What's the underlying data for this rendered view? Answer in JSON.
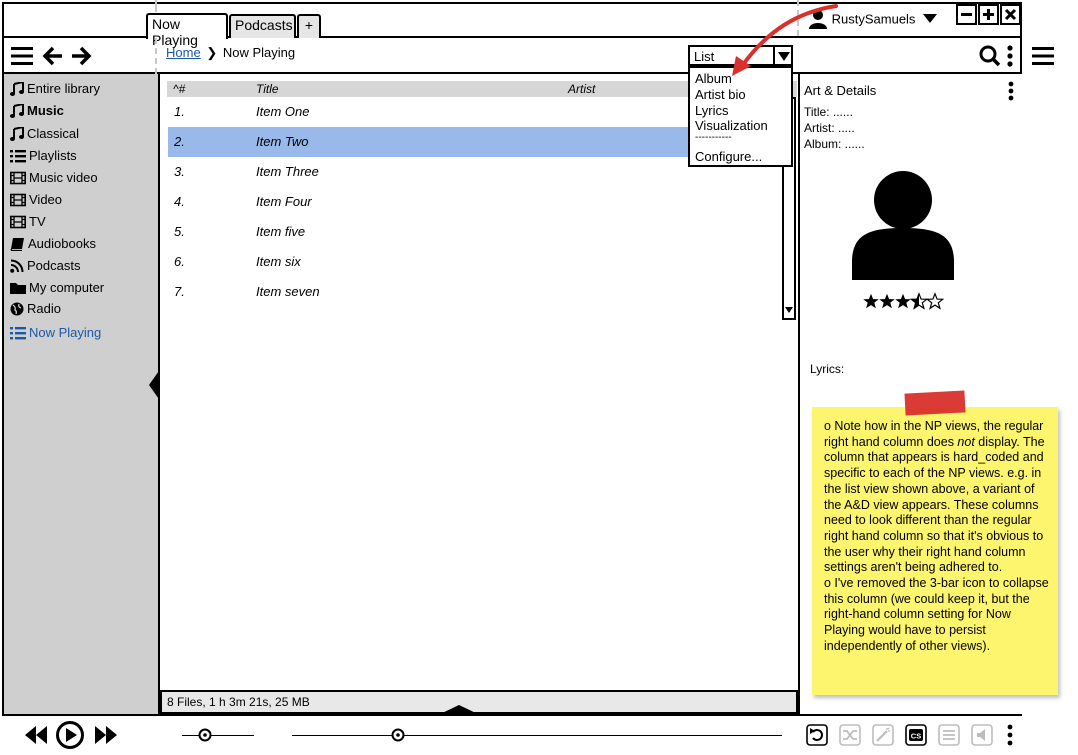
{
  "tabs": [
    {
      "label": "Now Playing",
      "active": true
    },
    {
      "label": "Podcasts",
      "active": false
    },
    {
      "label": "+",
      "active": false
    }
  ],
  "user": {
    "name": "RustySamuels"
  },
  "window_controls": {
    "minimize": "−",
    "maximize": "+",
    "close": "×"
  },
  "breadcrumb": {
    "home": "Home",
    "separator": "❯",
    "current": "Now Playing"
  },
  "view_select": {
    "value": "List",
    "options": [
      "Album",
      "Artist bio",
      "Lyrics",
      "Visualization",
      "-----------",
      "Configure..."
    ]
  },
  "sidebar": {
    "items": [
      {
        "label": "Entire library",
        "icon": "music-note-icon"
      },
      {
        "label": "Music",
        "icon": "music-note-icon",
        "bold": true
      },
      {
        "label": "Classical",
        "icon": "music-note-icon"
      },
      {
        "label": "Playlists",
        "icon": "list-icon"
      },
      {
        "label": "Music video",
        "icon": "film-icon"
      },
      {
        "label": "Video",
        "icon": "film-icon"
      },
      {
        "label": "TV",
        "icon": "film-icon"
      },
      {
        "label": "Audiobooks",
        "icon": "book-icon"
      },
      {
        "label": "Podcasts",
        "icon": "rss-icon"
      },
      {
        "label": "My computer",
        "icon": "folder-icon"
      },
      {
        "label": "Radio",
        "icon": "globe-icon"
      },
      {
        "label": "Now Playing",
        "icon": "list-icon",
        "active": true
      }
    ]
  },
  "list": {
    "columns": {
      "number": "^#",
      "title": "Title",
      "artist": "Artist"
    },
    "rows": [
      {
        "num": "1.",
        "title": "Item One"
      },
      {
        "num": "2.",
        "title": "Item Two",
        "selected": true
      },
      {
        "num": "3.",
        "title": "Item Three"
      },
      {
        "num": "4.",
        "title": "Item Four"
      },
      {
        "num": "5.",
        "title": "Item five"
      },
      {
        "num": "6.",
        "title": "Item six"
      },
      {
        "num": "7.",
        "title": "Item seven"
      }
    ]
  },
  "details": {
    "heading": "Art & Details",
    "title_label": "Title: ......",
    "artist_label": "Artist: .....",
    "album_label": "Album: ......",
    "rating": 3.5,
    "rating_max": 5,
    "lyrics_label": "Lyrics:"
  },
  "status": {
    "text": "8 Files, 1 h 3m 21s, 25 MB"
  },
  "note": {
    "line1_a": "o Note how in the NP views, the regular right hand column does ",
    "line1_em": "not",
    "line1_b": " display. The column that appears is hard_coded and specific to each of the NP views. e.g. in the list view shown above, a variant of the A&D view appears. These columns need to look different than the regular right hand column so that it's obvious to the user why their right hand column settings aren't being adhered to.",
    "line2": "o I've removed the 3-bar icon to collapse this column (we could keep it, but the right-hand column setting for Now Playing would have to persist independently of other views)."
  },
  "colors": {
    "selected_row": "#99b9ea",
    "sidebar_bg": "#cfcfcf",
    "sticky_note": "#fdf56d",
    "arrow": "#d9302c",
    "link": "#1d58a8"
  }
}
